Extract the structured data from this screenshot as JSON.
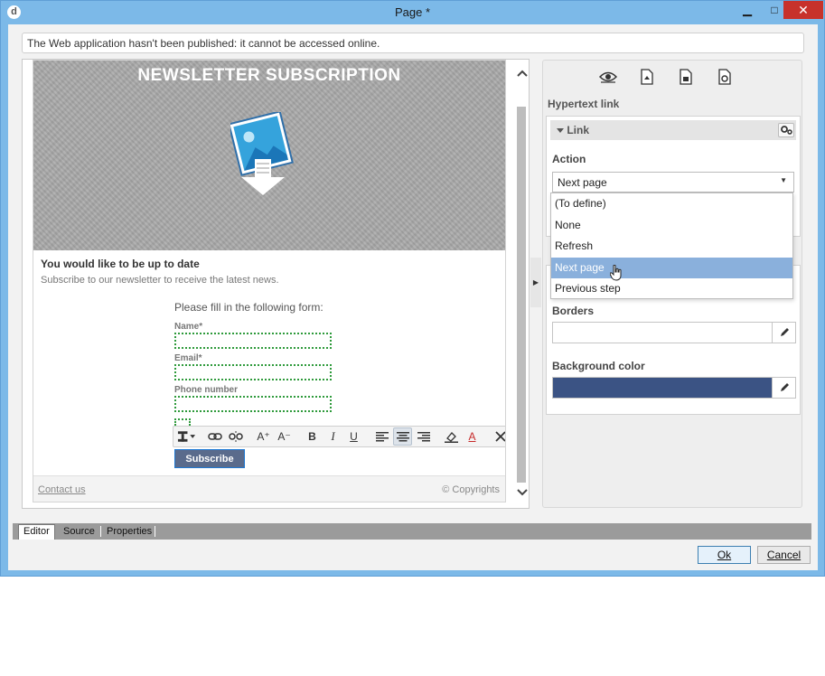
{
  "window": {
    "title": "Page *",
    "app_icon": "d",
    "minimize": "▁",
    "maximize": "□",
    "close": "✕"
  },
  "notice": "The Web application hasn't been published: it cannot be accessed online.",
  "editor": {
    "hero_title": "NEWSLETTER SUBSCRIPTION",
    "section_title": "You would like to be up to date",
    "section_subtitle": "Subscribe to our newsletter to receive the latest news.",
    "form_title": "Please fill in the following form:",
    "fields": [
      {
        "label": "Name*"
      },
      {
        "label": "Email*"
      },
      {
        "label": "Phone number"
      }
    ],
    "submit_label": "Subscribe",
    "footer_link": "Contact us",
    "footer_copyright": "© Copyrights",
    "toolbar": {
      "italic": "I",
      "bold": "B",
      "underline": "U",
      "grow": "A⁺",
      "shrink": "A⁻",
      "font_color": "A"
    }
  },
  "properties": {
    "panel_title": "Hypertext link",
    "group_title": "Link",
    "action_label": "Action",
    "action_value": "Next page",
    "action_options": [
      "(To define)",
      "None",
      "Refresh",
      "Next page",
      "Previous step"
    ],
    "selected_option_index": 3,
    "borders_label": "Borders",
    "background_color_label": "Background color",
    "background_color": "#3b5384"
  },
  "tabs": [
    "Editor",
    "Source",
    "Properties"
  ],
  "active_tab": "Editor",
  "buttons": {
    "ok": "Ok",
    "cancel": "Cancel"
  },
  "colors": {
    "accent": "#7cb9e8",
    "close": "#c7322b",
    "selection": "#8ab0dc",
    "field_border": "#2e9a3b"
  }
}
